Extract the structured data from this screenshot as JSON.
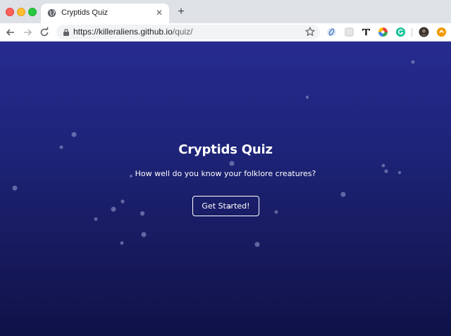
{
  "browser": {
    "tab": {
      "title": "Cryptids Quiz",
      "favicon": "globe-icon",
      "close_glyph": "✕"
    },
    "new_tab_glyph": "+",
    "address": {
      "scheme_host": "https://killeraliens.github.io",
      "path": "/quiz/"
    },
    "extensions": [
      "ring-extension-icon",
      "square-extension-icon",
      "text-extension-icon",
      "color-wheel-extension-icon",
      "grammarly-icon",
      "profile-avatar",
      "update-icon"
    ],
    "colors": {
      "tabstrip": "#dee1e6",
      "toolbar": "#ffffff",
      "omnibox": "#f1f3f4"
    }
  },
  "page": {
    "title": "Cryptids Quiz",
    "subtitle": "How well do you know your folklore creatures?",
    "cta_label": "Get Started!",
    "colors": {
      "background_top": "#262b8f",
      "background_bottom": "#0f1248",
      "text": "#ffffff",
      "particle": "#8a8fc4"
    }
  }
}
